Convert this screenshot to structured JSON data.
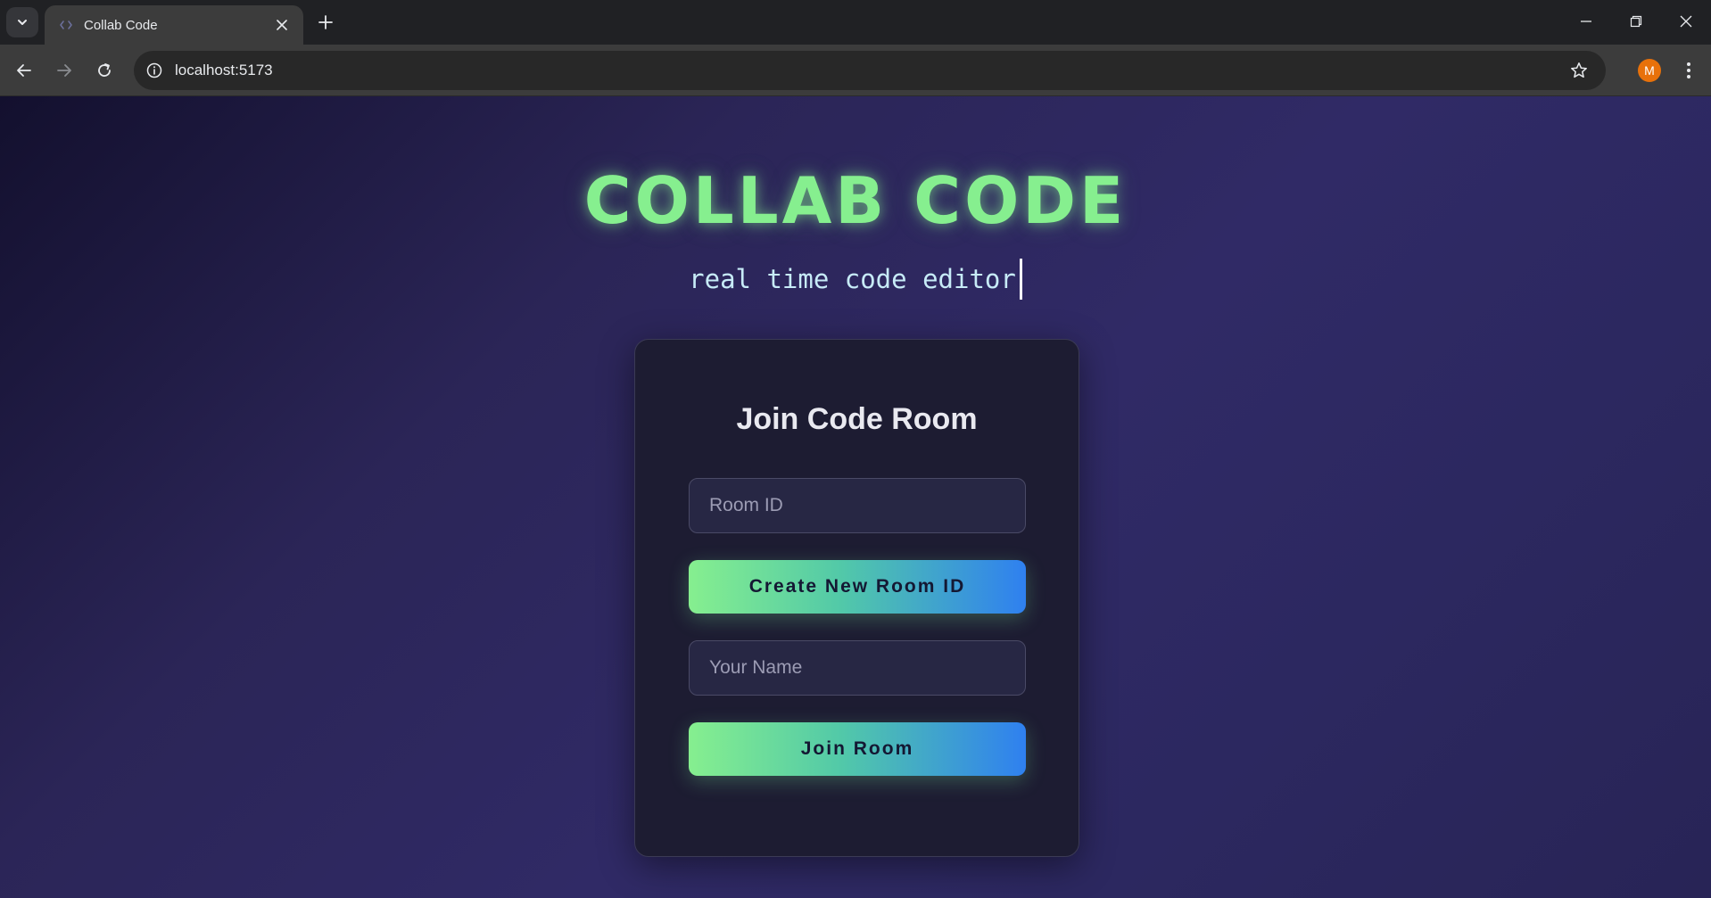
{
  "browser": {
    "tab_title": "Collab Code",
    "url": "localhost:5173",
    "profile_initial": "M",
    "icons": {
      "tab_search": "chevron-down-icon",
      "tab_close": "close-icon",
      "new_tab": "plus-icon",
      "back": "arrow-left-icon",
      "forward": "arrow-right-icon",
      "reload": "reload-icon",
      "site_info": "info-icon",
      "bookmark": "star-icon",
      "menu": "kebab-icon",
      "minimize": "minimize-icon",
      "restore": "restore-icon",
      "close_window": "close-icon"
    }
  },
  "hero": {
    "title": "COLLAB CODE",
    "subtitle": "real time code editor"
  },
  "card": {
    "title": "Join Code Room",
    "room_id_placeholder": "Room ID",
    "room_id_value": "",
    "create_button": "Create New Room ID",
    "name_placeholder": "Your Name",
    "name_value": "",
    "join_button": "Join Room"
  },
  "colors": {
    "accent_green": "#86ef8f",
    "accent_blue": "#2f80f0",
    "card_bg": "#1d1c32",
    "page_bg": "#2b2557",
    "avatar": "#e8710a"
  }
}
